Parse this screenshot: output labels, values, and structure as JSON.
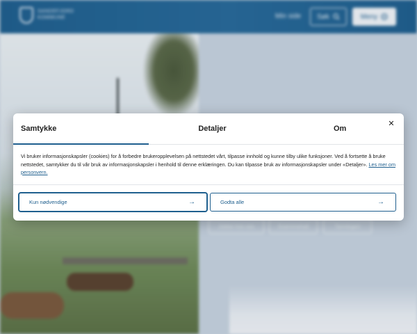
{
  "header": {
    "logo_line1": "SANDEFJORD",
    "logo_line2": "KOMMUNE",
    "my_page": "Min side",
    "search_label": "Søk",
    "menu_label": "Meny"
  },
  "background": {
    "tags": [
      "Jobbe hos oss",
      "Svømmehall",
      "Tannlegen"
    ]
  },
  "consent": {
    "tabs": [
      "Samtykke",
      "Detaljer",
      "Om"
    ],
    "close_symbol": "✕",
    "text": "Vi bruker informasjonskapsler (cookies) for å forbedre brukeropplevelsen på nettstedet vårt, tilpasse innhold og kunne tilby ulike funksjoner. Ved å fortsette å bruke nettstedet, samtykker du til vår bruk av informasjonskapsler i henhold til denne erklæringen. Du kan tilpasse bruk av informasjonskapsler under «Detaljer».",
    "link_text": "Les mer om personvern.",
    "button_necessary": "Kun nødvendige",
    "button_all": "Godta alle",
    "arrow_symbol": "→"
  },
  "colors": {
    "brand": "#1f5f8e",
    "header_bg": "#286a99"
  },
  "icons": {
    "search": "search-icon",
    "menu": "menu-icon",
    "close": "close-icon",
    "arrow": "arrow-right-icon"
  }
}
